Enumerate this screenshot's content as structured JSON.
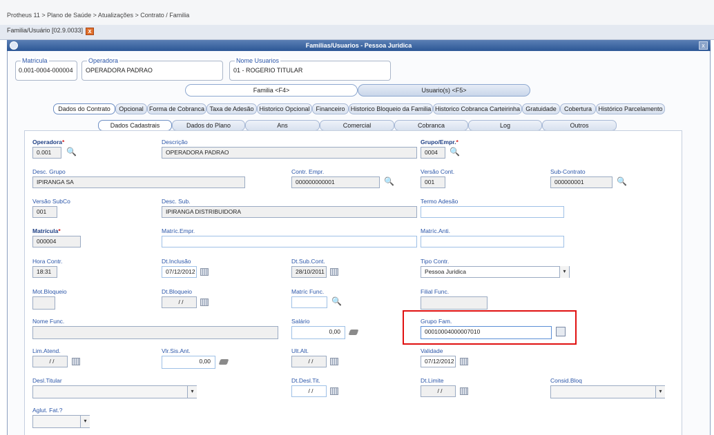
{
  "breadcrumb": "Protheus 11 > Plano de Saúde > Atualizações > Contrato / Familia",
  "doc_tab": "Familia/Usuário [02.9.0033]",
  "close_glyph": "x",
  "window_title": "Familias/Usuarios - Pessoa Juridica",
  "header": {
    "matricula": {
      "label": "Matricula",
      "value": "0.001-0004-000004"
    },
    "operadora": {
      "label": "Operadora",
      "value": "OPERADORA PADRAO"
    },
    "nome": {
      "label": "Nome Usuarios",
      "value": "01 - ROGERIO TITULAR"
    }
  },
  "switch": {
    "familia": "Familia <F4>",
    "usuarios": "Usuario(s) <F5>"
  },
  "main_tabs": [
    "Dados do Contrato",
    "Opcional",
    "Forma de Cobranca",
    "Taxa de Adesão",
    "Historico Opcional",
    "Financeiro",
    "Historico Bloqueio da Familia",
    "Historico Cobranca Carteirinha",
    "Gratuidade",
    "Cobertura",
    "Histórico Parcelamento"
  ],
  "sub_tabs": [
    "Dados Cadastrais",
    "Dados do Plano",
    "Ans",
    "Comercial",
    "Cobranca",
    "Log",
    "Outros"
  ],
  "fields": {
    "operadora": {
      "label": "Operadora",
      "value": "0.001"
    },
    "descricao": {
      "label": "Descrição",
      "value": "OPERADORA PADRAO"
    },
    "grupo_empr": {
      "label": "Grupo/Empr.",
      "value": "0004"
    },
    "desc_grupo": {
      "label": "Desc. Grupo",
      "value": "IPIRANGA SA"
    },
    "contr_empr": {
      "label": "Contr. Empr.",
      "value": "000000000001"
    },
    "versao_cont": {
      "label": "Versão Cont.",
      "value": "001"
    },
    "sub_contrato": {
      "label": "Sub-Contrato",
      "value": "000000001"
    },
    "versao_subco": {
      "label": "Versão SubCo",
      "value": "001"
    },
    "desc_sub": {
      "label": "Desc. Sub.",
      "value": "IPIRANGA DISTRIBUIDORA"
    },
    "termo_adesao": {
      "label": "Termo Adesão",
      "value": ""
    },
    "matricula": {
      "label": "Matrícula",
      "value": "000004"
    },
    "matric_empr": {
      "label": "Matríc.Empr.",
      "value": ""
    },
    "matric_anti": {
      "label": "Matríc.Anti.",
      "value": ""
    },
    "hora_contr": {
      "label": "Hora Contr.",
      "value": "18:31"
    },
    "dt_inclusao": {
      "label": "Dt.Inclusão",
      "value": "07/12/2012"
    },
    "dt_sub_cont": {
      "label": "Dt.Sub.Cont.",
      "value": "28/10/2011"
    },
    "tipo_contr": {
      "label": "Tipo Contr.",
      "value": "Pessoa Juridica"
    },
    "mot_bloqueio": {
      "label": "Mot.Bloqueio",
      "value": ""
    },
    "dt_bloqueio": {
      "label": "Dt.Bloqueio",
      "value": "/ /"
    },
    "matric_func": {
      "label": "Matríc Func.",
      "value": ""
    },
    "filial_func": {
      "label": "Filial Func.",
      "value": ""
    },
    "nome_func": {
      "label": "Nome Func.",
      "value": ""
    },
    "salario": {
      "label": "Salário",
      "value": "0,00"
    },
    "grupo_fam": {
      "label": "Grupo Fam.",
      "value": "00010004000007010"
    },
    "lim_atend": {
      "label": "Lim.Atend.",
      "value": "/ /"
    },
    "vlr_sis_ant": {
      "label": "Vlr.Sis.Ant.",
      "value": "0,00"
    },
    "ult_alt": {
      "label": "Ult.Alt.",
      "value": "/ /"
    },
    "validade": {
      "label": "Validade",
      "value": "07/12/2012"
    },
    "desl_titular": {
      "label": "Desl.Titular",
      "value": ""
    },
    "dt_desl_tit": {
      "label": "Dt.Desl.Tit.",
      "value": "/ /"
    },
    "dt_limite": {
      "label": "Dt.Limite",
      "value": "/ /"
    },
    "consid_bloq": {
      "label": "Consid.Bloq",
      "value": ""
    },
    "aglut_fat": {
      "label": "Aglut. Fat.?",
      "value": ""
    }
  },
  "required_mark": "*",
  "colors": {
    "title_bar": "#2c5796",
    "label": "#2a55a8",
    "highlight": "#e01010",
    "close": "#e0702c"
  }
}
